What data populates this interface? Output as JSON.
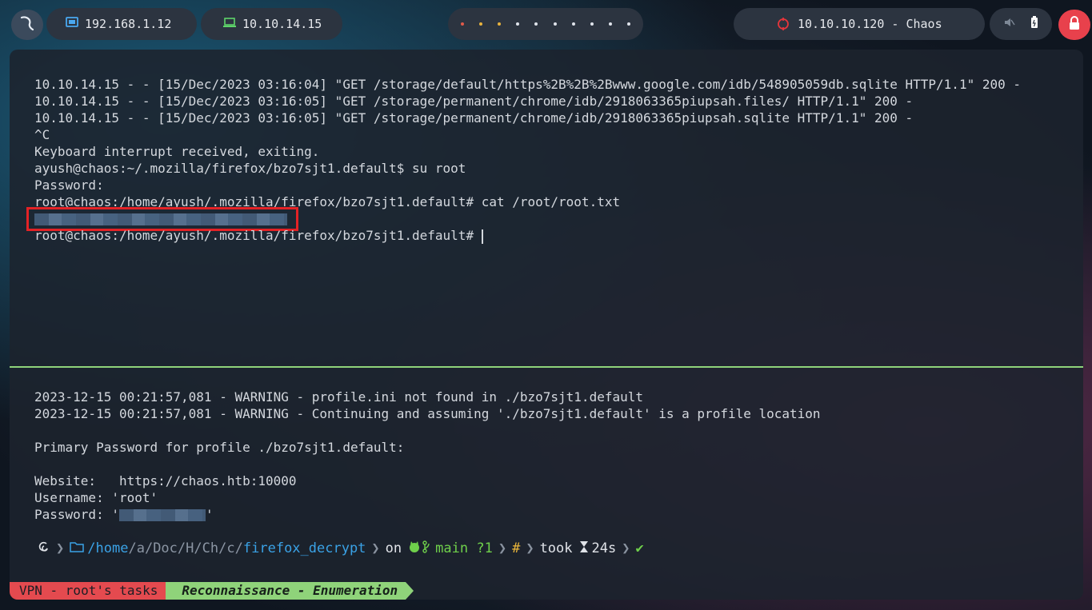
{
  "topbar": {
    "ip_local": "192.168.1.12",
    "ip_vpn": "10.10.14.15",
    "target": "10.10.10.120 - Chaos"
  },
  "terminal_top": {
    "lines": [
      "10.10.14.15 - - [15/Dec/2023 03:16:04] \"GET /storage/default/https%2B%2B%2Bwww.google.com/idb/548905059db.sqlite HTTP/1.1\" 200 -",
      "10.10.14.15 - - [15/Dec/2023 03:16:05] \"GET /storage/permanent/chrome/idb/2918063365piupsah.files/ HTTP/1.1\" 200 -",
      "10.10.14.15 - - [15/Dec/2023 03:16:05] \"GET /storage/permanent/chrome/idb/2918063365piupsah.sqlite HTTP/1.1\" 200 -",
      "^C",
      "Keyboard interrupt received, exiting.",
      "ayush@chaos:~/.mozilla/firefox/bzo7sjt1.default$ su root",
      "Password:",
      "root@chaos:/home/ayush/.mozilla/firefox/bzo7sjt1.default# cat /root/root.txt"
    ],
    "final_prompt": "root@chaos:/home/ayush/.mozilla/firefox/bzo7sjt1.default# "
  },
  "terminal_bottom": {
    "warn1": "2023-12-15 00:21:57,081 - WARNING - profile.ini not found in ./bzo7sjt1.default",
    "warn2": "2023-12-15 00:21:57,081 - WARNING - Continuing and assuming './bzo7sjt1.default' is a profile location",
    "primary": "Primary Password for profile ./bzo7sjt1.default:",
    "website": "Website:   https://chaos.htb:10000",
    "username": "Username: 'root'",
    "password_prefix": "Password: '",
    "password_suffix": "'"
  },
  "prompt": {
    "path_home": "/home",
    "path_a": "a",
    "path_doc": "Doc",
    "path_h": "H",
    "path_ch": "Ch",
    "path_c": "c",
    "path_dir": "firefox_decrypt",
    "on": "on",
    "branch": "main ?1",
    "hash": "#",
    "took": "took",
    "duration": "24s",
    "check": "✔"
  },
  "tmux": {
    "session": "VPN - root's tasks",
    "window": "Reconnaissance - Enumeration"
  },
  "colors": {
    "divider": "#8fd37a",
    "highlight": "#e32226",
    "tmux_left": "#e44a4f",
    "tmux_mid": "#8fd37a"
  }
}
